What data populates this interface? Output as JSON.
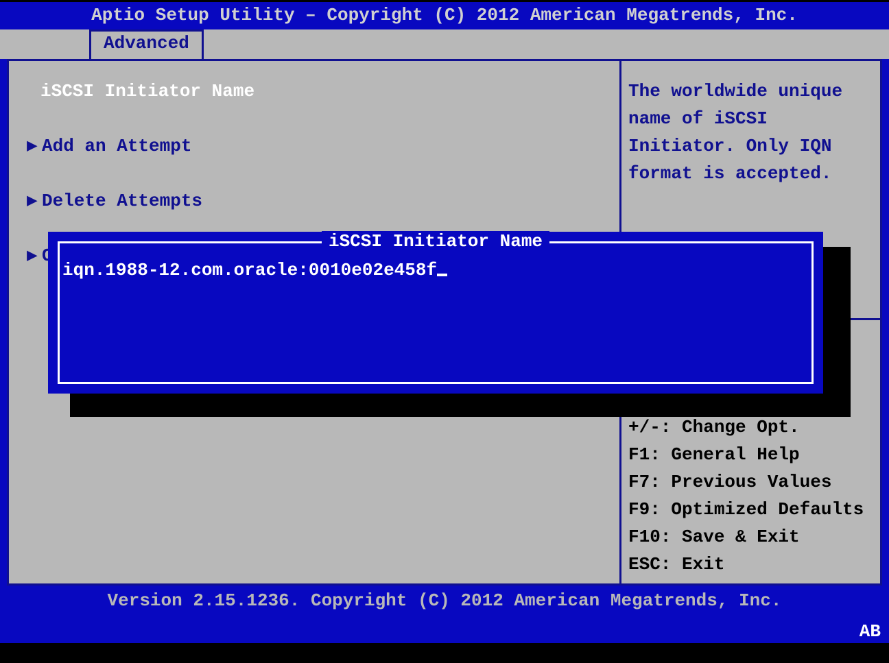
{
  "title": "Aptio Setup Utility – Copyright (C) 2012 American Megatrends, Inc.",
  "tab": "Advanced",
  "menu": {
    "header": "iSCSI Initiator Name",
    "items": [
      "Add an Attempt",
      "Delete Attempts",
      "Ch"
    ]
  },
  "help": "The worldwide unique name of iSCSI Initiator. Only IQN format is accepted.",
  "keys": [
    "+/-: Change Opt.",
    "F1: General Help",
    "F7: Previous Values",
    "F9: Optimized Defaults",
    "F10: Save & Exit",
    "ESC: Exit"
  ],
  "popup": {
    "title": "iSCSI Initiator Name",
    "value": "iqn.1988-12.com.oracle:0010e02e458f"
  },
  "footer": "Version 2.15.1236. Copyright (C) 2012 American Megatrends, Inc.",
  "corner": "AB"
}
